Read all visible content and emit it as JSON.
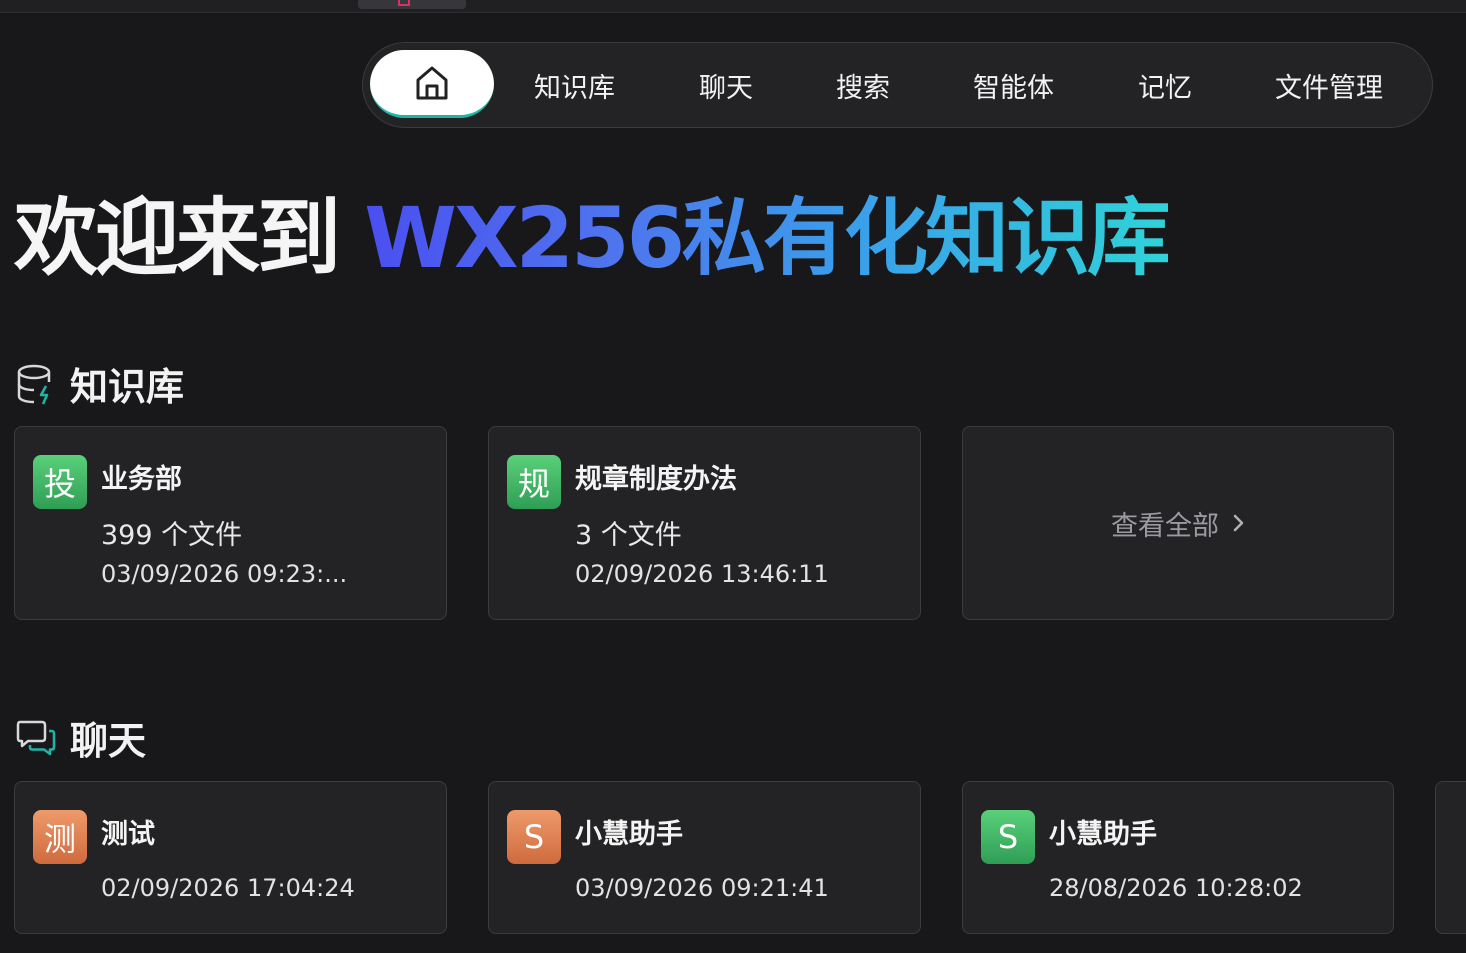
{
  "nav": {
    "home_icon": "home-icon",
    "items": [
      "知识库",
      "聊天",
      "搜索",
      "智能体",
      "记忆",
      "文件管理"
    ]
  },
  "hero": {
    "prefix": "欢迎来到 ",
    "highlight": "WX256私有化知识库"
  },
  "knowledge": {
    "title": "知识库",
    "icon": "database-icon",
    "cards": [
      {
        "badge": "投",
        "title": "业务部",
        "files": "399 个文件",
        "updated": "03/09/2026 09:23:..."
      },
      {
        "badge": "规",
        "title": "规章制度办法",
        "files": "3 个文件",
        "updated": "02/09/2026 13:46:11"
      }
    ],
    "view_all": "查看全部"
  },
  "chat": {
    "title": "聊天",
    "icon": "chat-icon",
    "cards": [
      {
        "badge": "测",
        "title": "测试",
        "updated": "02/09/2026 17:04:24"
      },
      {
        "badge": "S",
        "title": "小慧助手",
        "updated": "03/09/2026 09:21:41"
      },
      {
        "badge": "S",
        "title": "小慧助手",
        "updated": "28/08/2026 10:28:02"
      }
    ]
  },
  "colors": {
    "background": "#18181b",
    "card": "#232326",
    "accent_teal": "#1fb5a6",
    "gradient_start": "#4a4ff0",
    "gradient_end": "#2fd3d8",
    "badge_green": "#3fb864",
    "badge_orange": "#e07f4f"
  }
}
